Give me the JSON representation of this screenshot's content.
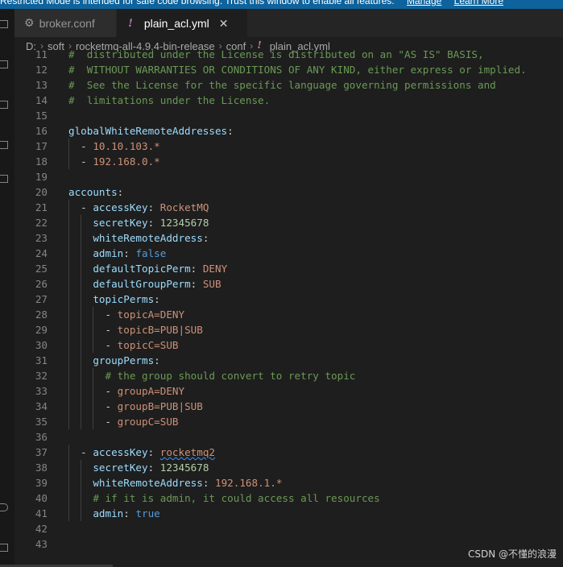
{
  "banner": {
    "text": "Restricted Mode is intended for safe code browsing. Trust this window to enable all features.",
    "manage": "Manage",
    "learn_more": "Learn More"
  },
  "tabs": [
    {
      "label": "broker.conf",
      "icon": "gear-icon"
    },
    {
      "label": "plain_acl.yml",
      "icon": "exclamation-icon",
      "active": true
    }
  ],
  "breadcrumb": [
    "D:",
    "soft",
    "rocketmq-all-4.9.4-bin-release",
    "conf",
    "plain_acl.yml"
  ],
  "code": [
    {
      "n": "11",
      "tokens": [
        [
          "#  distributed under the License is distributed on an \"AS IS\" BASIS,",
          "com"
        ]
      ]
    },
    {
      "n": "12",
      "tokens": [
        [
          "#  WITHOUT WARRANTIES OR CONDITIONS OF ANY KIND, either express or implied.",
          "com"
        ]
      ]
    },
    {
      "n": "13",
      "tokens": [
        [
          "#  See the License for the specific language governing permissions and",
          "com"
        ]
      ]
    },
    {
      "n": "14",
      "tokens": [
        [
          "#  limitations under the License.",
          "com"
        ]
      ]
    },
    {
      "n": "15",
      "tokens": []
    },
    {
      "n": "16",
      "tokens": [
        [
          "globalWhiteRemoteAddresses",
          "key"
        ],
        [
          ":",
          "pun"
        ]
      ]
    },
    {
      "n": "17",
      "tokens": [
        [
          "  - ",
          "pun"
        ],
        [
          "10.10.103.*",
          "str"
        ]
      ]
    },
    {
      "n": "18",
      "tokens": [
        [
          "  - ",
          "pun"
        ],
        [
          "192.168.0.*",
          "str"
        ]
      ]
    },
    {
      "n": "19",
      "tokens": []
    },
    {
      "n": "20",
      "tokens": [
        [
          "accounts",
          "key"
        ],
        [
          ":",
          "pun"
        ]
      ]
    },
    {
      "n": "21",
      "tokens": [
        [
          "  - ",
          "pun"
        ],
        [
          "accessKey",
          "key"
        ],
        [
          ": ",
          "pun"
        ],
        [
          "RocketMQ",
          "str"
        ]
      ]
    },
    {
      "n": "22",
      "tokens": [
        [
          "    ",
          "pun"
        ],
        [
          "secretKey",
          "key"
        ],
        [
          ": ",
          "pun"
        ],
        [
          "12345678",
          "num"
        ]
      ]
    },
    {
      "n": "23",
      "tokens": [
        [
          "    ",
          "pun"
        ],
        [
          "whiteRemoteAddress",
          "key"
        ],
        [
          ":",
          "pun"
        ]
      ]
    },
    {
      "n": "24",
      "tokens": [
        [
          "    ",
          "pun"
        ],
        [
          "admin",
          "key"
        ],
        [
          ": ",
          "pun"
        ],
        [
          "false",
          "bool"
        ]
      ]
    },
    {
      "n": "25",
      "tokens": [
        [
          "    ",
          "pun"
        ],
        [
          "defaultTopicPerm",
          "key"
        ],
        [
          ": ",
          "pun"
        ],
        [
          "DENY",
          "str"
        ]
      ]
    },
    {
      "n": "26",
      "tokens": [
        [
          "    ",
          "pun"
        ],
        [
          "defaultGroupPerm",
          "key"
        ],
        [
          ": ",
          "pun"
        ],
        [
          "SUB",
          "str"
        ]
      ]
    },
    {
      "n": "27",
      "tokens": [
        [
          "    ",
          "pun"
        ],
        [
          "topicPerms",
          "key"
        ],
        [
          ":",
          "pun"
        ]
      ]
    },
    {
      "n": "28",
      "tokens": [
        [
          "      - ",
          "pun"
        ],
        [
          "topicA=DENY",
          "str"
        ]
      ]
    },
    {
      "n": "29",
      "tokens": [
        [
          "      - ",
          "pun"
        ],
        [
          "topicB=PUB|SUB",
          "str"
        ]
      ]
    },
    {
      "n": "30",
      "tokens": [
        [
          "      - ",
          "pun"
        ],
        [
          "topicC=SUB",
          "str"
        ]
      ]
    },
    {
      "n": "31",
      "tokens": [
        [
          "    ",
          "pun"
        ],
        [
          "groupPerms",
          "key"
        ],
        [
          ":",
          "pun"
        ]
      ]
    },
    {
      "n": "32",
      "tokens": [
        [
          "      ",
          "pun"
        ],
        [
          "# the group should convert to retry topic",
          "com"
        ]
      ]
    },
    {
      "n": "33",
      "tokens": [
        [
          "      - ",
          "pun"
        ],
        [
          "groupA=DENY",
          "str"
        ]
      ]
    },
    {
      "n": "34",
      "tokens": [
        [
          "      - ",
          "pun"
        ],
        [
          "groupB=PUB|SUB",
          "str"
        ]
      ]
    },
    {
      "n": "35",
      "tokens": [
        [
          "      - ",
          "pun"
        ],
        [
          "groupC=SUB",
          "str"
        ]
      ]
    },
    {
      "n": "36",
      "tokens": []
    },
    {
      "n": "37",
      "tokens": [
        [
          "  - ",
          "pun"
        ],
        [
          "accessKey",
          "key"
        ],
        [
          ": ",
          "pun"
        ],
        [
          "rocketmq2",
          "str-squiggle"
        ]
      ]
    },
    {
      "n": "38",
      "tokens": [
        [
          "    ",
          "pun"
        ],
        [
          "secretKey",
          "key"
        ],
        [
          ": ",
          "pun"
        ],
        [
          "12345678",
          "num"
        ]
      ]
    },
    {
      "n": "39",
      "tokens": [
        [
          "    ",
          "pun"
        ],
        [
          "whiteRemoteAddress",
          "key"
        ],
        [
          ": ",
          "pun"
        ],
        [
          "192.168.1.*",
          "str"
        ]
      ]
    },
    {
      "n": "40",
      "tokens": [
        [
          "    ",
          "pun"
        ],
        [
          "# if it is admin, it could access all resources",
          "com"
        ]
      ]
    },
    {
      "n": "41",
      "tokens": [
        [
          "    ",
          "pun"
        ],
        [
          "admin",
          "key"
        ],
        [
          ": ",
          "pun"
        ],
        [
          "true",
          "bool"
        ]
      ]
    },
    {
      "n": "42",
      "tokens": []
    },
    {
      "n": "43",
      "tokens": []
    }
  ],
  "watermark": "CSDN @不懂的浪漫",
  "colors": {
    "comment": "#6a9955",
    "key": "#9cdcfe",
    "string": "#ce9178",
    "number": "#b5cea8",
    "boolean": "#569cd6",
    "accent": "#0e639c"
  }
}
